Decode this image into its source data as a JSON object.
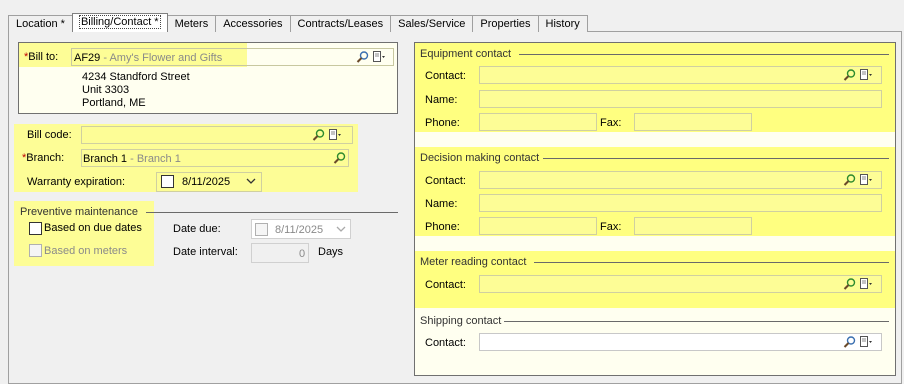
{
  "tabs": [
    {
      "label": "Location *"
    },
    {
      "label": "Billing/Contact *"
    },
    {
      "label": "Meters"
    },
    {
      "label": "Accessories"
    },
    {
      "label": "Contracts/Leases"
    },
    {
      "label": "Sales/Service"
    },
    {
      "label": "Properties"
    },
    {
      "label": "History"
    }
  ],
  "bill_to": {
    "required_mark": "*",
    "label": "Bill to:",
    "code": "AF29",
    "separator": " - ",
    "name": "Amy's Flower and Gifts",
    "address_line1": "4234 Standford Street",
    "address_line2": "Unit 3303",
    "address_line3": "Portland, ME"
  },
  "bill_code": {
    "label": "Bill code:",
    "value": ""
  },
  "branch": {
    "required_mark": "*",
    "label": "Branch:",
    "code": "Branch 1",
    "separator": " - ",
    "name": "Branch 1"
  },
  "warranty": {
    "label": "Warranty expiration:",
    "value": "8/11/2025"
  },
  "preventive": {
    "title": "Preventive maintenance",
    "due_dates_label": "Based on due dates",
    "meters_label": "Based on meters",
    "date_due_label": "Date due:",
    "date_due_value": "8/11/2025",
    "date_interval_label": "Date interval:",
    "date_interval_value": "0",
    "days_label": "Days"
  },
  "equipment_contact": {
    "title": "Equipment contact",
    "contact_label": "Contact:",
    "name_label": "Name:",
    "phone_label": "Phone:",
    "fax_label": "Fax:"
  },
  "decision_contact": {
    "title": "Decision making contact",
    "contact_label": "Contact:",
    "name_label": "Name:",
    "phone_label": "Phone:",
    "fax_label": "Fax:"
  },
  "meter_contact": {
    "title": "Meter reading contact",
    "contact_label": "Contact:"
  },
  "shipping_contact": {
    "title": "Shipping contact",
    "contact_label": "Contact:"
  },
  "colors": {
    "highlight": "#fdfd96",
    "required": "#c00000",
    "hint_text": "#8a8a8a"
  },
  "icons": [
    "search-icon",
    "note-dropdown-icon",
    "calendar-dropdown-icon",
    "checkbox"
  ]
}
